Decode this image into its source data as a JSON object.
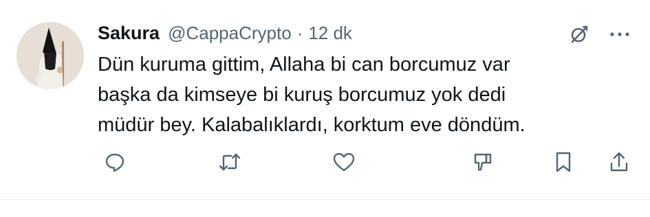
{
  "tweet": {
    "display_name": "Sakura",
    "handle": "@CappaCrypto",
    "separator": "·",
    "time": "12 dk",
    "text_lines": [
      "Dün kuruma gittim, Allaha bi can borcumuz var",
      "başka da kimseye bi kuruş borcumuz yok dedi",
      "müdür bey. Kalabalıklardı, korktum eve döndüm."
    ]
  },
  "icons": {
    "grok": "grok-icon",
    "more": "more-icon",
    "reply": "reply-icon",
    "retweet": "retweet-icon",
    "like": "like-icon",
    "downvote": "downvote-icon",
    "bookmark": "bookmark-icon",
    "share": "share-icon"
  },
  "colors": {
    "text_primary": "#0f1419",
    "text_secondary": "#536471",
    "divider": "#eff3f4"
  }
}
